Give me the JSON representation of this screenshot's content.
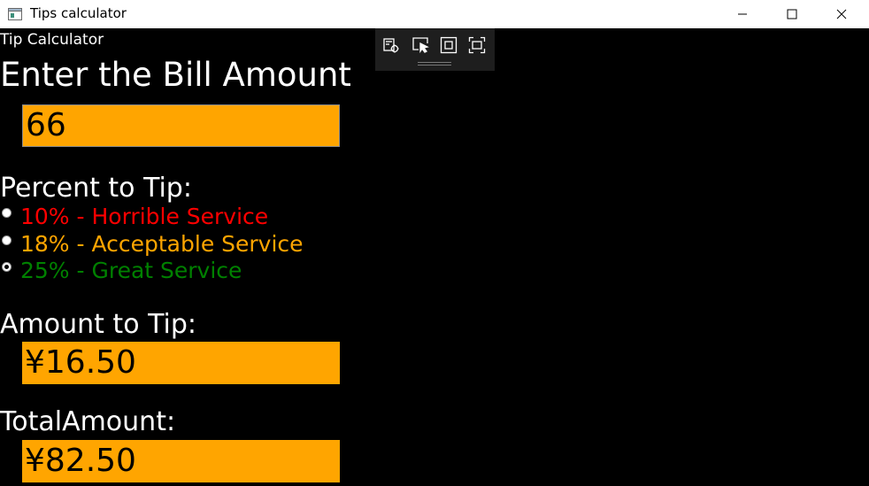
{
  "window": {
    "title": "Tips calculator"
  },
  "icons": {
    "app": "app-window-icon",
    "minimize": "minimize-icon",
    "maximize": "maximize-icon",
    "close": "close-icon",
    "debug_tools": [
      "app-properties-icon",
      "select-element-icon",
      "display-layout-adorners-icon",
      "track-focus-icon"
    ]
  },
  "app": {
    "heading": "Tip Calculator",
    "bill_label": "Enter the Bill Amount",
    "bill_value": "66",
    "percent_label": "Percent to Tip:",
    "options": [
      {
        "label": "10% - Horrible Service",
        "color": "#ff0000",
        "checked": false
      },
      {
        "label": "18% - Acceptable Service",
        "color": "#ffa500",
        "checked": false
      },
      {
        "label": "25% - Great Service",
        "color": "#008000",
        "checked": true
      }
    ],
    "amount_label": "Amount to Tip:",
    "amount_value": "¥16.50",
    "total_label": "TotalAmount:",
    "total_value": "¥82.50"
  },
  "colors": {
    "background": "#000000",
    "field_fill": "#ffa500",
    "text": "#ffffff"
  }
}
